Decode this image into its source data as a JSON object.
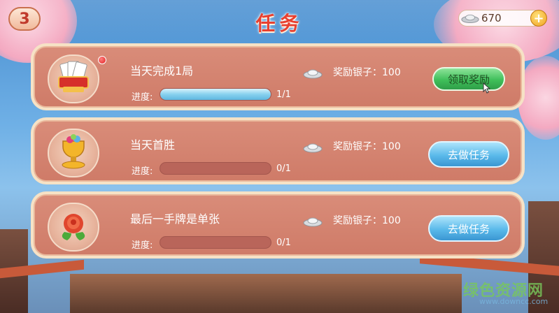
{
  "header": {
    "title": "任务",
    "back_label": "3",
    "coins": "670",
    "add_label": "+"
  },
  "tasks": [
    {
      "name": "当天完成1局",
      "progress_label": "进度:",
      "progress": 1.0,
      "progress_count": "1/1",
      "reward": "奖励银子：100",
      "button": "领取奖励",
      "button_type": "claim",
      "icon": "playing-cards-icon",
      "icon_text": "对局",
      "has_notification": true
    },
    {
      "name": "当天首胜",
      "progress_label": "进度:",
      "progress": 0.0,
      "progress_count": "0/1",
      "reward": "奖励银子：100",
      "button": "去做任务",
      "button_type": "go",
      "icon": "trophy-icon",
      "has_notification": false
    },
    {
      "name": "最后一手牌是单张",
      "progress_label": "进度:",
      "progress": 0.0,
      "progress_count": "0/1",
      "reward": "奖励银子：100",
      "button": "去做任务",
      "button_type": "go",
      "icon": "rose-icon",
      "has_notification": false
    }
  ],
  "watermark": {
    "main": "绿色资源网",
    "sub": "www.downcc.com"
  },
  "colors": {
    "title": "#e8402f",
    "card": "#d98c79",
    "claim_button": "#3fbf5a",
    "go_button": "#5ab9ea",
    "progress_fill": "#88d1ee"
  }
}
